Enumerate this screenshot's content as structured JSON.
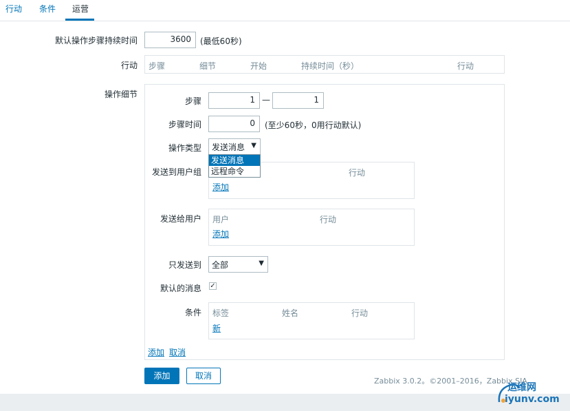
{
  "tabs": [
    "行动",
    "条件",
    "运营"
  ],
  "default_duration": {
    "label": "默认操作步骤持续时间",
    "value": "3600",
    "note": "(最低60秒)"
  },
  "actions": {
    "label": "行动",
    "columns": [
      "步骤",
      "细节",
      "开始",
      "持续时间（秒）",
      "行动"
    ]
  },
  "operation": {
    "label": "操作细节",
    "steps": {
      "label": "步骤",
      "from": "1",
      "to": "1",
      "separator": "—"
    },
    "step_time": {
      "label": "步骤时间",
      "value": "0",
      "note": "(至少60秒，0用行动默认)"
    },
    "op_type": {
      "label": "操作类型",
      "selected": "发送消息",
      "options": [
        "发送消息",
        "远程命令"
      ]
    },
    "send_groups": {
      "label": "发送到用户组",
      "col_action": "行动",
      "add": "添加"
    },
    "send_users": {
      "label": "发送给用户",
      "columns": [
        "用户",
        "行动"
      ],
      "add": "添加"
    },
    "send_only": {
      "label": "只发送到",
      "selected": "全部"
    },
    "default_msg": {
      "label": "默认的消息",
      "checked": true
    },
    "conditions": {
      "label": "条件",
      "columns": [
        "标签",
        "姓名",
        "行动"
      ],
      "new": "新"
    },
    "add_link": "添加",
    "cancel_link": "取消"
  },
  "buttons": {
    "add": "添加",
    "cancel": "取消"
  },
  "footer": "Zabbix 3.0.2。©2001–2016，Zabbix SIA",
  "watermark": {
    "cn": "运维网",
    "url": "iyunv.com"
  },
  "colors": {
    "accent": "#0275b8",
    "text": "#1f2c33",
    "muted": "#768d99",
    "border": "#dfe4e7"
  }
}
